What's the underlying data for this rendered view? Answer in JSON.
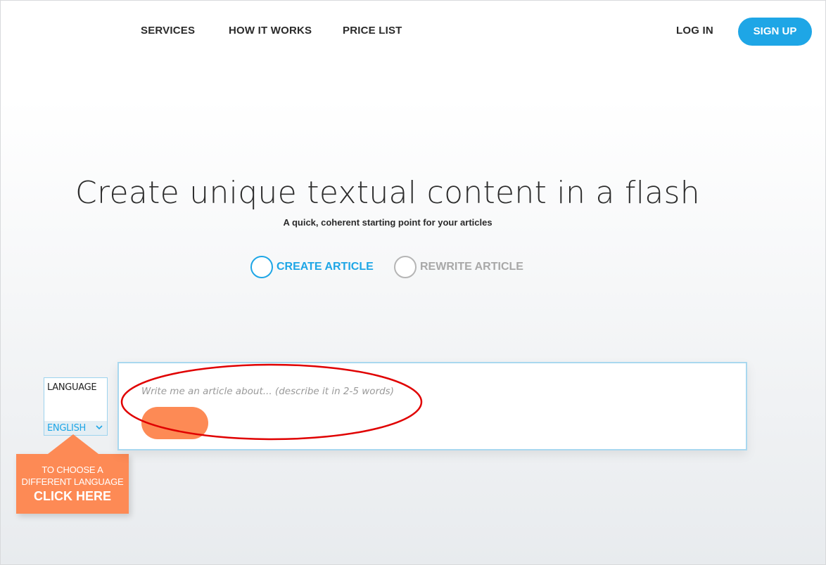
{
  "nav": {
    "services": "SERVICES",
    "how_it_works": "HOW IT WORKS",
    "price_list": "PRICE LIST",
    "login": "LOG IN",
    "signup": "SIGN UP"
  },
  "hero": {
    "title": "Create unique textual content in a flash",
    "subtitle": "A quick, coherent starting point for your articles"
  },
  "modes": {
    "create": {
      "label": "CREATE ARTICLE",
      "selected": true
    },
    "rewrite": {
      "label": "REWRITE ARTICLE",
      "selected": false
    }
  },
  "language": {
    "title": "LANGUAGE",
    "value": "ENGLISH"
  },
  "tooltip": {
    "line1": "TO CHOOSE A",
    "line2": "DIFFERENT LANGUAGE",
    "cta": "CLICK HERE"
  },
  "editor": {
    "placeholder": "Write me an article about... (describe it in 2-5 words)",
    "value": ""
  },
  "colors": {
    "accent_blue": "#1ea6e6",
    "accent_orange": "#fd8a55",
    "annotation_red": "#e00000"
  }
}
